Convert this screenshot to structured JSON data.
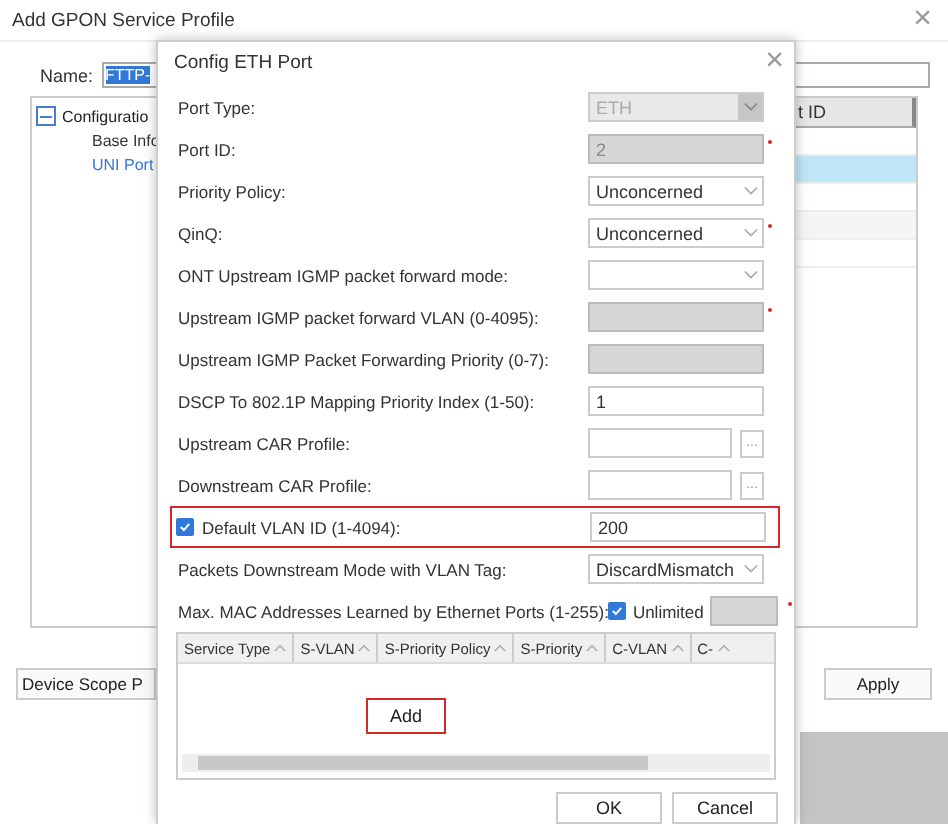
{
  "window": {
    "title": "Add GPON Service Profile",
    "close": "×"
  },
  "name_field": {
    "label": "Name:",
    "value": "FTTP-"
  },
  "tree": [
    {
      "label": "Configuratio",
      "expanded": true,
      "children": [
        {
          "label": "Base Infc",
          "selected": false
        },
        {
          "label": "UNI Port",
          "selected": true
        }
      ]
    }
  ],
  "list": {
    "header": "t ID",
    "rows": [
      {
        "selected": false
      },
      {
        "selected": true
      },
      {
        "selected": false
      },
      {
        "selected": false
      },
      {
        "selected": false
      }
    ]
  },
  "buttons": [
    "Device Scope P",
    "Apply"
  ],
  "dialog": {
    "title": "Config ETH Port",
    "close": "×",
    "fields": [
      {
        "kind": "select",
        "label": "Port Type:",
        "value": "ETH",
        "disabled": true,
        "required": false
      },
      {
        "kind": "input",
        "label": "Port ID:",
        "value": "2",
        "disabled": true,
        "required": true
      },
      {
        "kind": "select",
        "label": "Priority Policy:",
        "value": "Unconcerned",
        "disabled": false,
        "required": false
      },
      {
        "kind": "select",
        "label": "QinQ:",
        "value": "Unconcerned",
        "disabled": false,
        "required": true
      },
      {
        "kind": "select",
        "label": "ONT Upstream IGMP packet forward mode:",
        "disabled": false,
        "required": false
      },
      {
        "kind": "input",
        "label": "Upstream IGMP packet forward VLAN (0-4095):",
        "disabled": true,
        "required": true
      },
      {
        "kind": "input",
        "label": "Upstream IGMP Packet Forwarding Priority (0-7):",
        "disabled": true,
        "required": false
      },
      {
        "kind": "input",
        "label": "DSCP To 802.1P Mapping Priority Index (1-50):",
        "value": "1",
        "disabled": false,
        "required": false
      },
      {
        "kind": "browse",
        "label": "Upstream CAR Profile:",
        "button": "...",
        "disabled": false,
        "required": false
      },
      {
        "kind": "browse",
        "label": "Downstream CAR Profile:",
        "button": "...",
        "disabled": false,
        "required": false
      },
      {
        "kind": "check_input",
        "label": "Default VLAN ID (1-4094):",
        "checked": true,
        "value": "200",
        "highlighted": true,
        "disabled": false,
        "required": false
      },
      {
        "kind": "select",
        "label": "Packets Downstream Mode with VLAN Tag:",
        "value": "DiscardMismatch",
        "disabled": false,
        "required": false
      },
      {
        "kind": "limit",
        "label": "Max. MAC Addresses Learned by Ethernet Ports (1-255):",
        "option": "Unlimited",
        "checked": true,
        "disabled": true,
        "required": true
      }
    ],
    "table": {
      "columns": [
        "Service Type",
        "S-VLAN",
        "S-Priority Policy",
        "S-Priority",
        "C-VLAN",
        "C-"
      ],
      "add_button": "Add"
    },
    "buttons": [
      "OK",
      "Cancel"
    ]
  }
}
